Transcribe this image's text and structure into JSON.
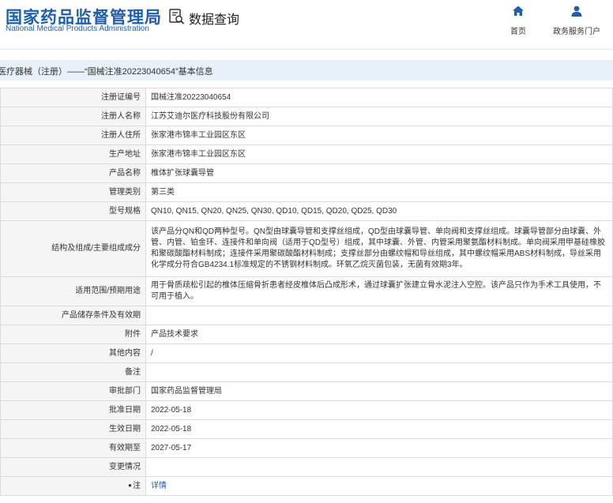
{
  "header": {
    "org_name_cn": "国家药品监督管理局",
    "org_name_en": "National Medical Products Administration",
    "query_title": "数据查询",
    "nav": [
      {
        "label": "首页",
        "icon": "home-icon"
      },
      {
        "label": "政务服务门户",
        "icon": "user-icon"
      }
    ]
  },
  "breadcrumb": "医疗器械（注册）——“国械注准20223040654”基本信息",
  "rows": [
    {
      "key": "注册证编号",
      "value": "国械注准20223040654"
    },
    {
      "key": "注册人名称",
      "value": "江苏艾迪尔医疗科技股份有限公司"
    },
    {
      "key": "注册人住所",
      "value": "张家港市锦丰工业园区东区"
    },
    {
      "key": "生产地址",
      "value": "张家港市锦丰工业园区东区"
    },
    {
      "key": "产品名称",
      "value": "椎体扩张球囊导管"
    },
    {
      "key": "管理类别",
      "value": "第三类"
    },
    {
      "key": "型号规格",
      "value": "QN10, QN15, QN20, QN25, QN30, QD10, QD15, QD20, QD25, QD30"
    },
    {
      "key": "结构及组成/主要组成成分",
      "value": "该产品分QN和QD两种型号。QN型由球囊导管和支撑丝组成，QD型由球囊导管、单向阀和支撑丝组成。球囊导管部分由球囊、外管、内管、铂金环、连接件和单向阀（适用于QD型号）组成，其中球囊、外管、内管采用聚氨酯材料制成。单向阀采用甲基硅橡胶和聚碳酸酯材料制成；连接件采用聚碳酸酯材料制成；支撑丝部分由螺纹帽和导丝组成，其中螺纹帽采用ABS材料制成，导丝采用化学成分符合GB4234.1标准规定的不锈钢材料制成。环氧乙烷灭菌包装，无菌有效期3年。"
    },
    {
      "key": "适用范围/预期用途",
      "value": "用于骨质疏松引起的椎体压缩骨折患者经皮椎体后凸成形术，通过球囊扩张建立骨水泥注入空腔。该产品只作为手术工具使用，不可用于植入。"
    },
    {
      "key": "产品储存条件及有效期",
      "value": ""
    },
    {
      "key": "附件",
      "value": "产品技术要求"
    },
    {
      "key": "其他内容",
      "value": "/"
    },
    {
      "key": "备注",
      "value": ""
    },
    {
      "key": "审批部门",
      "value": "国家药品监督管理局"
    },
    {
      "key": "批准日期",
      "value": "2022-05-18"
    },
    {
      "key": "生效日期",
      "value": "2022-05-18"
    },
    {
      "key": "有效期至",
      "value": "2027-05-17"
    },
    {
      "key": "变更情况",
      "value": ""
    },
    {
      "key": "注",
      "value": "详情",
      "link": true
    }
  ]
}
